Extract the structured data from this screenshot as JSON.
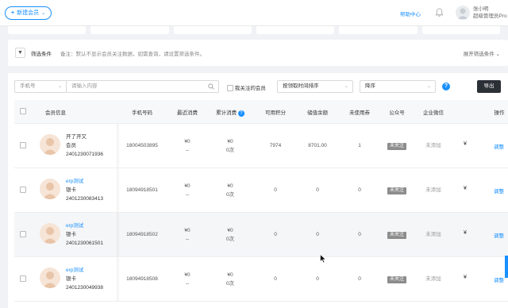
{
  "topbar": {
    "new_button": "新建会员",
    "help_link": "帮助中心",
    "user_name": "张小明",
    "user_role": "超级管理员Pro"
  },
  "filter": {
    "title": "筛选条件",
    "note": "备注：默认不显示会员关注数据，如需查询，请设置筛选条件。",
    "expand": "展开筛选条件"
  },
  "toolbar": {
    "search_type": "手机号",
    "search_placeholder": "请输入内容",
    "follow_label": "我关注的会员",
    "sort_select": "按领取时间排序",
    "order_select": "降序",
    "export_label": "导出"
  },
  "columns": [
    "会员信息",
    "手机号码",
    "最近消费",
    "累计消费",
    "可用积分",
    "储值余额",
    "未使用券",
    "公众号",
    "企业微信",
    "操作"
  ],
  "rows": [
    {
      "nick": "开了开又",
      "level": "会员",
      "code": "2401230071936",
      "phone": "18004503895",
      "recent_amount": "¥0",
      "recent_time": "--",
      "total_amount": "¥0",
      "total_times": "0次",
      "points": "7974",
      "balance": "8701.00",
      "coupons": "1",
      "official": "未关注",
      "wecom": "未添加",
      "ext": "¥",
      "action": "调整"
    },
    {
      "nick": "erp测试",
      "level": "银卡",
      "code": "2401230083413",
      "phone": "18094918501",
      "recent_amount": "¥0",
      "recent_time": "--",
      "total_amount": "¥0",
      "total_times": "0次",
      "points": "0",
      "balance": "0",
      "coupons": "0",
      "official": "未关注",
      "wecom": "未添加",
      "ext": "¥",
      "action": "调整"
    },
    {
      "nick": "erp测试",
      "level": "银卡",
      "code": "2401230061501",
      "phone": "18094918502",
      "recent_amount": "¥0",
      "recent_time": "--",
      "total_amount": "¥0",
      "total_times": "0次",
      "points": "0",
      "balance": "0",
      "coupons": "0",
      "official": "未关注",
      "wecom": "未添加",
      "ext": "¥",
      "action": "调整"
    },
    {
      "nick": "erp测试",
      "level": "银卡",
      "code": "2401230049938",
      "phone": "18094918508",
      "recent_amount": "¥0",
      "recent_time": "--",
      "total_amount": "¥0",
      "total_times": "0次",
      "points": "0",
      "balance": "0",
      "coupons": "0",
      "official": "未关注",
      "wecom": "未添加",
      "ext": "¥",
      "action": "调整"
    }
  ],
  "colors": {
    "accent": "#1890ff",
    "badge": "#8c8c8c",
    "export_bg": "#2b2f36"
  }
}
